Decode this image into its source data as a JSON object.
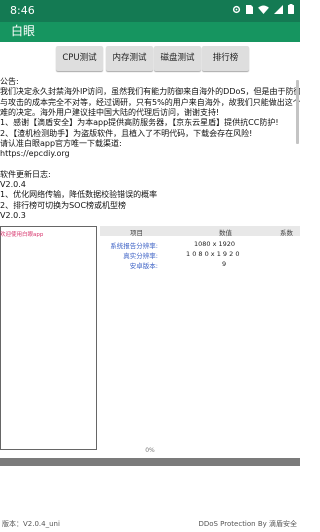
{
  "status_bar": {
    "time": "8:46"
  },
  "app": {
    "title": "白眼"
  },
  "tabs": [
    {
      "label": "CPU测试"
    },
    {
      "label": "内存测试"
    },
    {
      "label": "磁盘测试"
    },
    {
      "label": "排行榜"
    }
  ],
  "notice_lines": [
    "公告:",
    "我们决定永久封禁海外IP访问，虽然我们有能力防御来自海外的DDoS，但是由于防御",
    "与攻击的成本完全不对等，经过调研，只有5%的用户来自海外，故我们只能做出这个艰",
    "难的决定。海外用户建议挂中国大陆的代理后访问，谢谢支持!",
    "1、感谢【滴盾安全】为本app提供高防服务器，【京东云星盾】提供抗CC防护!",
    "2、【渣机检测助手】为盗版软件，且植入了不明代码，下载会存在风险!",
    "请认准白眼app官方唯一下载渠道:",
    "https://epcdiy.org",
    "",
    "软件更新日志:",
    "V2.0.4",
    "1、优化网络传输，降低数据校验错误的概率",
    "2、排行榜可切换为SOC榜或机型榜",
    "V2.0.3"
  ],
  "welcome": "欢迎使用白眼app",
  "table": {
    "headers": [
      "项目",
      "数值",
      "系数"
    ],
    "rows": [
      {
        "label": "系统报告分辨率:",
        "value": "1080 x 1920"
      },
      {
        "label": "真实分辨率:",
        "value": "1 0 8 0 x 1 9 2 0"
      },
      {
        "label": "安卓版本:",
        "value": "9"
      }
    ]
  },
  "progress": {
    "label": "0%",
    "value": 0
  },
  "footer": {
    "version": "版本：V2.0.4_uni",
    "protection": "DDoS Protection By 滴盾安全"
  },
  "colors": {
    "status_bar": "#147a53",
    "app_bar": "#169560",
    "label_blue": "#3e63c6",
    "welcome_pink": "#d7346c"
  },
  "icons": [
    "settings-icon",
    "sim-icon",
    "wifi-icon",
    "signal-icon",
    "battery-icon"
  ]
}
